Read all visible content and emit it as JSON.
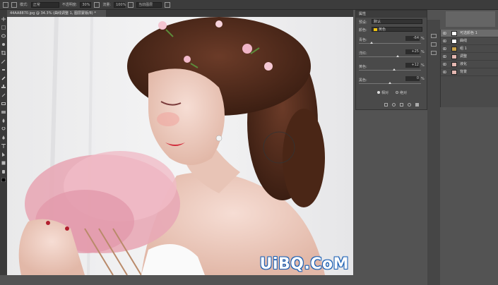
{
  "options_bar": {
    "mode_label": "模式:",
    "mode_value": "正常",
    "opacity_label": "不透明度:",
    "opacity_value": "30%",
    "flow_label": "流量:",
    "flow_value": "100%",
    "sample_value": "当前图层"
  },
  "document_tab": {
    "title": "44AA8870.jpg @ 34.3% (曲线调整 1, 图层蒙版/8) *"
  },
  "properties_panel": {
    "title": "属性",
    "preset_label": "预设:",
    "preset_value": "默认",
    "color_label": "颜色:",
    "color_value": "黄色",
    "rows": [
      {
        "label": "青色:",
        "value": "-64",
        "unit": "%"
      },
      {
        "label": "洋红:",
        "value": "+25",
        "unit": "%"
      },
      {
        "label": "黄色:",
        "value": "+12",
        "unit": "%"
      },
      {
        "label": "黑色:",
        "value": "0",
        "unit": "%"
      }
    ],
    "radio_relative": "相对",
    "radio_absolute": "绝对"
  },
  "layers": [
    {
      "name": "可选颜色 1",
      "selected": true
    },
    {
      "name": "曲线",
      "selected": false
    },
    {
      "name": "组 1",
      "selected": false
    },
    {
      "name": "调整",
      "selected": false
    },
    {
      "name": "液化",
      "selected": false
    },
    {
      "name": "背景",
      "selected": false
    }
  ],
  "watermark": "UiBQ.CoM",
  "colors": {
    "chrome": "#3c3c3c",
    "panel": "#4a4a4a",
    "accent": "#2a6ec8",
    "selected_layer": "#6c6c6c"
  }
}
